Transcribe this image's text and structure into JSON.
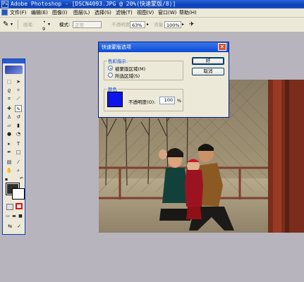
{
  "window": {
    "title": "Adobe Photoshop - [DSCN4093.JPG @ 20%(快速蒙版/8)]"
  },
  "menu": [
    "文件(F)",
    "编辑(E)",
    "图像(I)",
    "图层(L)",
    "选择(S)",
    "滤镜(T)",
    "视图(V)",
    "窗口(W)",
    "帮助(H)"
  ],
  "options": {
    "brush_label": "画笔:",
    "brush_size": "9",
    "mode_label": "模式:",
    "mode_value": "正常",
    "opacity_label": "不透明度:",
    "opacity_value": "63%",
    "flow_label": "流量:",
    "flow_value": "100%"
  },
  "dialog": {
    "title": "快速蒙版选项",
    "group_color_indicates": "色彩指示:",
    "radio_masked": "被蒙版区域(M)",
    "radio_selected": "所选区域(S)",
    "group_color": "颜色",
    "opacity_label": "不透明度(O):",
    "opacity_value": "100",
    "opacity_unit": "%",
    "ok_label": "好",
    "cancel_label": "取消",
    "mask_color": "#0c16e8"
  }
}
